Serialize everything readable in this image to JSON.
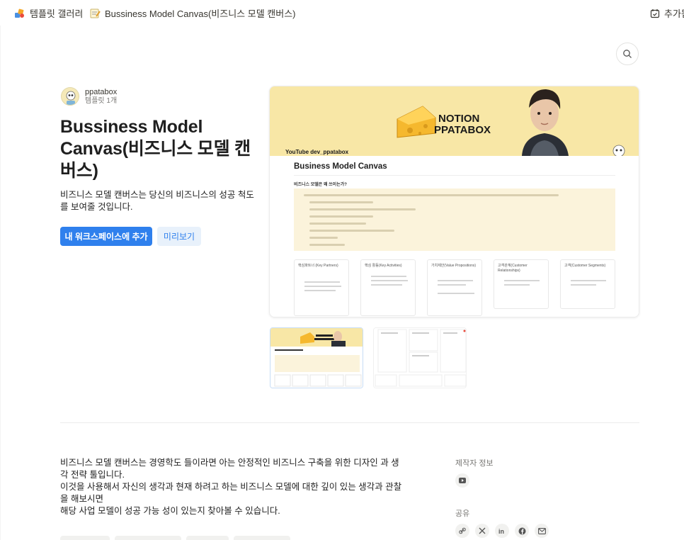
{
  "breadcrumb": {
    "root": "템플릿 갤러리",
    "separator": "/",
    "page": "Bussiness Model Canvas(비즈니스 모델 캔버스)"
  },
  "topbar": {
    "add_label": "추가됨"
  },
  "author": {
    "name": "ppatabox",
    "templates": "템플릿 1개"
  },
  "template": {
    "title": "Bussiness Model Canvas(비즈니스 모델 캔버스)",
    "description": "비즈니스 모델 캔버스는 당신의 비즈니스의 성공 척도를 보여줄 것입니다.",
    "add_button": "내 워크스페이스에 추가",
    "preview_button": "미리보기"
  },
  "preview": {
    "banner_text_line1": "NOTION",
    "banner_text_line2": "PPATABOX",
    "banner_channel": "YouTube  dev_ppatabox",
    "page_title": "Business Model Canvas",
    "section_heading": "비즈니스 모델은 왜 쓰이는가?",
    "cards": [
      {
        "label": "핵심파트너 (Key Partners)"
      },
      {
        "label": "핵심 활동(Key Activities)"
      },
      {
        "label": "가치제안(Value Propositions)"
      },
      {
        "label": "고객관계(Customer Relationships)"
      },
      {
        "label": "고객(Customer Segments)"
      }
    ]
  },
  "about": {
    "lines": [
      "비즈니스 모델 캔버스는 경영학도 들이라면 아는 안정적인 비즈니스 구축을 위한 디자인 과 생각 전략 툴입니다.",
      "이것을 사용해서 자신의 생각과 현재 하려고 하는 비즈니스 모델에 대한 깊이 있는 생각과 관찰을 해보시면",
      "해당 사업 모델이 성공 가능 성이 있는지 찾아볼 수 있습니다."
    ]
  },
  "sidebar": {
    "creator_info_label": "제작자 정보",
    "share_label": "공유",
    "share_icons": [
      "link-icon",
      "x-icon",
      "linkedin-icon",
      "facebook-icon",
      "mail-icon"
    ]
  },
  "colors": {
    "primary": "#2f80ed",
    "primary_soft": "#e8f1fb",
    "banner": "#f8e7a6",
    "callout": "#fbf3db"
  }
}
